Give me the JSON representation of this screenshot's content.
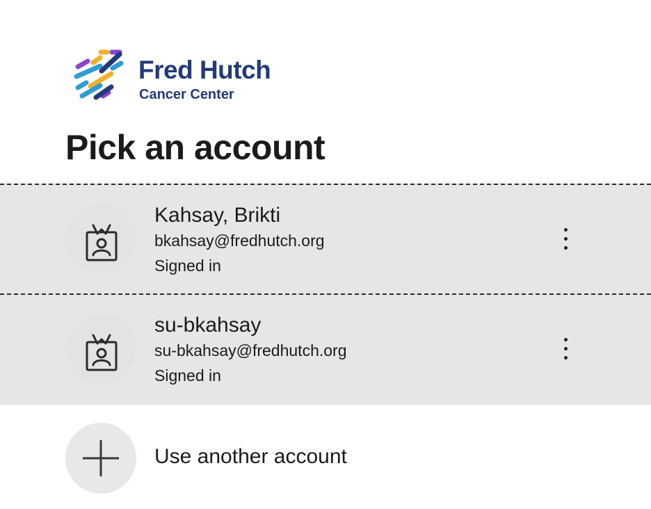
{
  "logo": {
    "title": "Fred Hutch",
    "subtitle": "Cancer Center",
    "colors": [
      "#8e44c8",
      "#f1b12a",
      "#2f9bd6",
      "#233a7a"
    ]
  },
  "page_title": "Pick an account",
  "accounts": [
    {
      "name": "Kahsay, Brikti",
      "email": "bkahsay@fredhutch.org",
      "status": "Signed in",
      "icon": "badge-icon"
    },
    {
      "name": "su-bkahsay",
      "email": "su-bkahsay@fredhutch.org",
      "status": "Signed in",
      "icon": "badge-icon"
    }
  ],
  "other_account": {
    "label": "Use another account",
    "icon": "plus-icon"
  },
  "colors": {
    "row_background": "#e6e6e6",
    "text": "#1b1b1b",
    "brand_navy": "#233a7a"
  }
}
